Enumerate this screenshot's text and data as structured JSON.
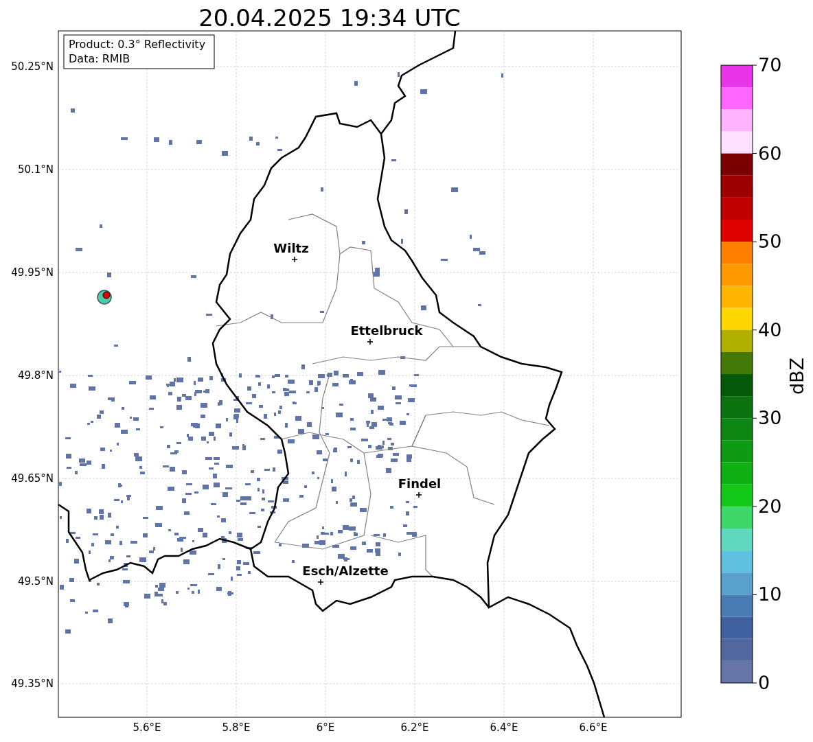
{
  "title": "20.04.2025 19:34 UTC",
  "info_box": {
    "lines": [
      "Product: 0.3° Reflectivity",
      "Data: RMIB"
    ]
  },
  "map": {
    "yticks": [
      "50.25°N",
      "50.1°N",
      "49.95°N",
      "49.8°N",
      "49.65°N",
      "49.5°N",
      "49.35°N"
    ],
    "xticks": [
      "5.6°E",
      "5.8°E",
      "6°E",
      "6.2°E",
      "6.4°E",
      "6.6°E"
    ],
    "places": [
      {
        "name": "Wiltz"
      },
      {
        "name": "Ettelbruck"
      },
      {
        "name": "Findel"
      },
      {
        "name": "Esch/Alzette"
      }
    ]
  },
  "colorbar": {
    "label": "dBZ",
    "ticks": [
      "70",
      "60",
      "50",
      "40",
      "30",
      "20",
      "10",
      "0"
    ],
    "segments": [
      {
        "color": "#e935e9"
      },
      {
        "color": "#ff66ff"
      },
      {
        "color": "#ffb3ff"
      },
      {
        "color": "#ffe0ff"
      },
      {
        "color": "#7a0000"
      },
      {
        "color": "#9c0000"
      },
      {
        "color": "#be0000"
      },
      {
        "color": "#e00000"
      },
      {
        "color": "#ff7f00"
      },
      {
        "color": "#ff9900"
      },
      {
        "color": "#ffb400"
      },
      {
        "color": "#ffd700"
      },
      {
        "color": "#b0b000"
      },
      {
        "color": "#457a08"
      },
      {
        "color": "#055a0a"
      },
      {
        "color": "#0a720f"
      },
      {
        "color": "#0c8513"
      },
      {
        "color": "#0f9a14"
      },
      {
        "color": "#10b015"
      },
      {
        "color": "#12c818"
      },
      {
        "color": "#3fd66a"
      },
      {
        "color": "#60d8c0"
      },
      {
        "color": "#60c0e0"
      },
      {
        "color": "#5aa0cc"
      },
      {
        "color": "#4a7cb4"
      },
      {
        "color": "#4060a0"
      },
      {
        "color": "#50689e"
      },
      {
        "color": "#6674a8"
      }
    ]
  }
}
